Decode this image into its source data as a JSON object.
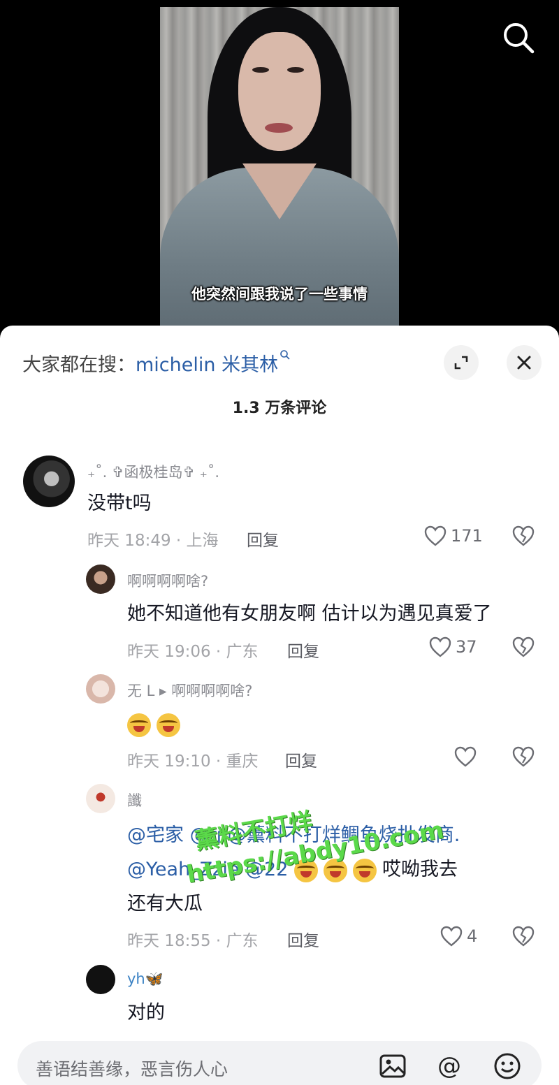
{
  "video": {
    "subtitle": "他突然间跟我说了一些事情",
    "search_icon": "search-icon"
  },
  "sheet": {
    "search_hint_prefix": "大家都在搜：",
    "search_hint_keyword": "michelin 米其林",
    "comment_count": "1.3 万条评论",
    "expand_icon": "expand-icon",
    "close_icon": "close-icon"
  },
  "comments": [
    {
      "username": "₊˚. ✞函极桂岛✞ ₊˚.",
      "text": "没带t吗",
      "meta": "昨天 18:49 · 上海",
      "reply_label": "回复",
      "likes": "171"
    },
    {
      "username": "啊啊啊啊啥?",
      "text": "她不知道他有女朋友啊 估计以为遇见真爱了",
      "meta": "昨天 19:06 · 广东",
      "reply_label": "回复",
      "likes": "37"
    },
    {
      "username": "无 L ▸ 啊啊啊啊啥?",
      "text": "",
      "meta": "昨天 19:10 · 重庆",
      "reply_label": "回复",
      "likes": ""
    },
    {
      "username": "讖",
      "line1": "@宅家  @rj @薰料不打烊鲷鱼烧批发商.",
      "line2_mention": "@Yeah_Zzie @22",
      "line2_text": "哎呦我去",
      "line3": "还有大瓜",
      "meta": "昨天 18:55 · 广东",
      "reply_label": "回复",
      "likes": "4"
    },
    {
      "username": "yh🦋",
      "text": "对的"
    }
  ],
  "watermark": {
    "line1": "薰料不打烊",
    "line2": "https://abdy10.com"
  },
  "input": {
    "placeholder": "善语结善缘，恶言伤人心",
    "image_icon": "image-icon",
    "at_icon": "at-icon",
    "emoji_icon": "emoji-icon"
  }
}
